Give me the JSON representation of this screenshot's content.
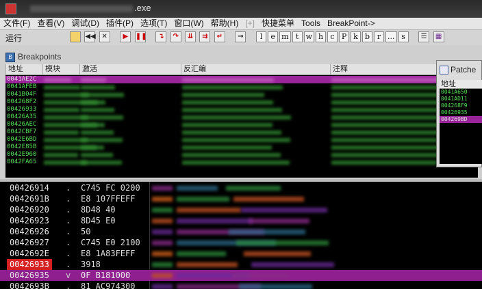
{
  "window": {
    "title_suffix": ".exe"
  },
  "menu": [
    {
      "label": "文件(F)"
    },
    {
      "label": "查看(V)"
    },
    {
      "label": "调试(D)"
    },
    {
      "label": "插件(P)"
    },
    {
      "label": "选项(T)"
    },
    {
      "label": "窗口(W)"
    },
    {
      "label": "帮助(H)"
    },
    {
      "label": "[+]",
      "dim": true
    },
    {
      "label": "快捷菜单"
    },
    {
      "label": "Tools"
    },
    {
      "label": "BreakPoint->"
    }
  ],
  "toolbar": {
    "status_label": "运行",
    "letters": [
      "l",
      "e",
      "m",
      "t",
      "w",
      "h",
      "c",
      "P",
      "k",
      "b",
      "r",
      "...",
      "s"
    ]
  },
  "breakpoints": {
    "title": "Breakpoints",
    "columns": [
      "地址",
      "模块",
      "激活",
      "反汇编",
      "注释"
    ],
    "rows": [
      {
        "address": "0041AE2C",
        "selected": true
      },
      {
        "address": "0041AFEB"
      },
      {
        "address": "0041B04F"
      },
      {
        "address": "004268F2"
      },
      {
        "address": "00426933"
      },
      {
        "address": "00426A35"
      },
      {
        "address": "00426AEC"
      },
      {
        "address": "0042CBF7"
      },
      {
        "address": "0042E6BD"
      },
      {
        "address": "0042E85B"
      },
      {
        "address": "0042E960"
      },
      {
        "address": "0042FA65"
      }
    ]
  },
  "patches": {
    "title": "Patche",
    "column": "地址",
    "rows": [
      {
        "address": "0041A650"
      },
      {
        "address": "0041AD11"
      },
      {
        "address": "004268F9"
      },
      {
        "address": "00426935"
      },
      {
        "address": "004269BD",
        "selected": true
      }
    ]
  },
  "disassembly": {
    "rows": [
      {
        "address": "00426914",
        "mark": ".",
        "hex": "C745 FC 0200"
      },
      {
        "address": "0042691B",
        "mark": ".",
        "hex": "E8 107FFEFF"
      },
      {
        "address": "00426920",
        "mark": ".",
        "hex": "8D48 40"
      },
      {
        "address": "00426923",
        "mark": ".",
        "hex": "8D45 E0"
      },
      {
        "address": "00426926",
        "mark": ".",
        "hex": "50"
      },
      {
        "address": "00426927",
        "mark": ".",
        "hex": "C745 E0 2100"
      },
      {
        "address": "0042692E",
        "mark": ".",
        "hex": "E8 1A83FEFF"
      },
      {
        "address": "00426933",
        "mark": ".",
        "hex": "3918",
        "breakpoint": true
      },
      {
        "address": "00426935",
        "mark": "v",
        "hex": "0F   B181000",
        "selected": true
      },
      {
        "address": "0042693B",
        "mark": ".",
        "hex": "81 AC974300"
      }
    ]
  },
  "colors": {
    "breakpoint": "#d42020",
    "selection": "#8f1f8f",
    "listing_text": "#55e055"
  }
}
